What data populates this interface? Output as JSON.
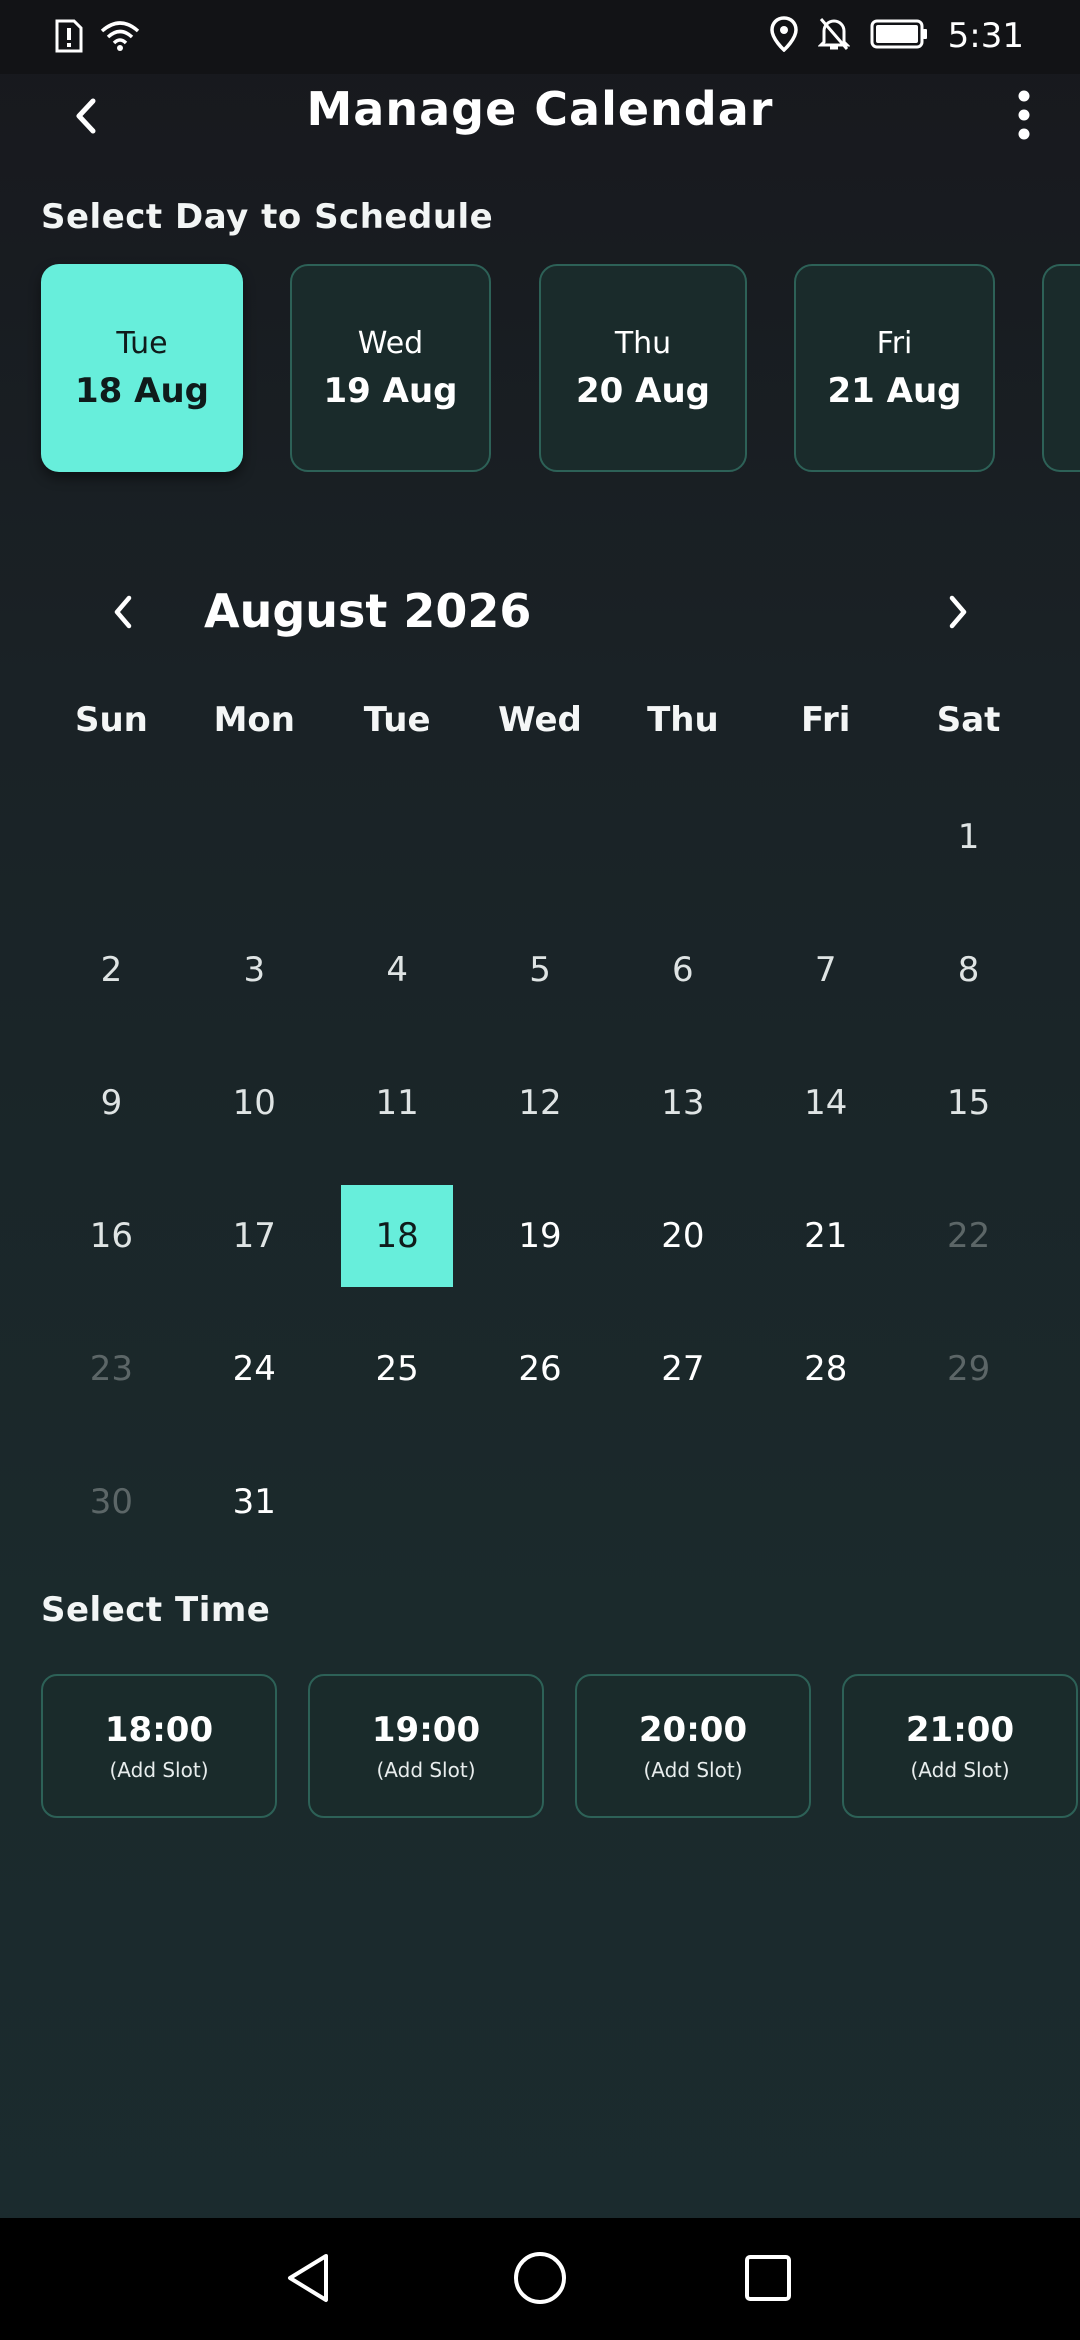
{
  "status_bar": {
    "time": "5:31",
    "icons": [
      "sim-alert-icon",
      "wifi-icon",
      "location-icon",
      "bell-off-icon",
      "battery-icon"
    ]
  },
  "header": {
    "title": "Manage Calendar",
    "back_icon": "chevron-left-icon",
    "menu_icon": "more-vertical-icon"
  },
  "day_selector": {
    "label": "Select Day to Schedule",
    "days": [
      {
        "weekday": "Tue",
        "date": "18 Aug",
        "selected": true
      },
      {
        "weekday": "Wed",
        "date": "19 Aug",
        "selected": false
      },
      {
        "weekday": "Thu",
        "date": "20 Aug",
        "selected": false
      },
      {
        "weekday": "Fri",
        "date": "21 Aug",
        "selected": false
      }
    ]
  },
  "calendar": {
    "month_title": "August 2026",
    "weekdays": [
      "Sun",
      "Mon",
      "Tue",
      "Wed",
      "Thu",
      "Fri",
      "Sat"
    ],
    "weeks": [
      [
        "",
        "",
        "",
        "",
        "",
        "",
        "1"
      ],
      [
        "2",
        "3",
        "4",
        "5",
        "6",
        "7",
        "8"
      ],
      [
        "9",
        "10",
        "11",
        "12",
        "13",
        "14",
        "15"
      ],
      [
        "16",
        "17",
        "18",
        "19",
        "20",
        "21",
        "22"
      ],
      [
        "23",
        "24",
        "25",
        "26",
        "27",
        "28",
        "29"
      ],
      [
        "30",
        "31",
        "",
        "",
        "",
        "",
        ""
      ]
    ],
    "selected_day": "18",
    "disabled_days": [
      "22",
      "23",
      "29",
      "30"
    ]
  },
  "time_selector": {
    "label": "Select Time",
    "slots": [
      {
        "time": "18:00",
        "action": "(Add Slot)"
      },
      {
        "time": "19:00",
        "action": "(Add Slot)"
      },
      {
        "time": "20:00",
        "action": "(Add Slot)"
      },
      {
        "time": "21:00",
        "action": "(Add Slot)"
      }
    ]
  },
  "colors": {
    "accent": "#67eedb",
    "card_border": "#2d6157",
    "card_bg": "#1a2b2b"
  }
}
